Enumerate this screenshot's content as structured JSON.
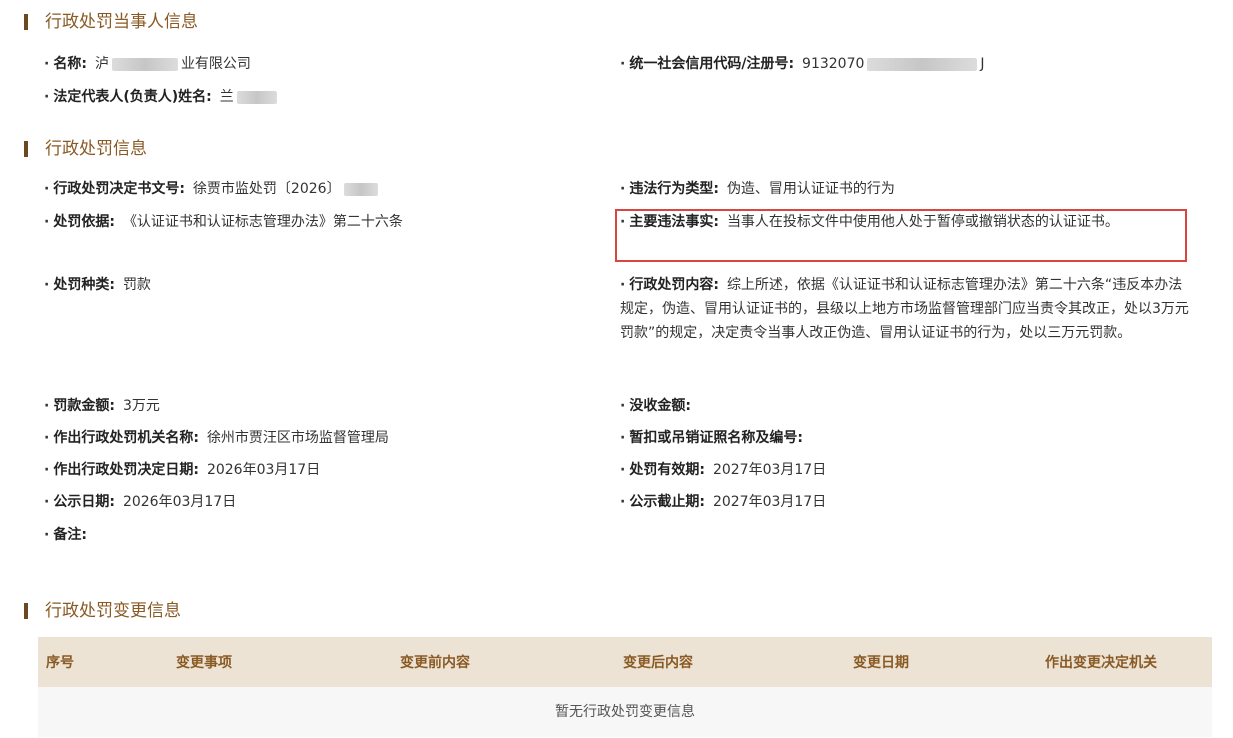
{
  "party": {
    "title": "行政处罚当事人信息",
    "name_label": "名称:",
    "name_prefix": "泸",
    "name_suffix": "业有限公司",
    "credit_label": "统一社会信用代码/注册号:",
    "credit_prefix": "9132070",
    "credit_suffix": "J",
    "rep_label": "法定代表人(负责人)姓名:",
    "rep_prefix": "兰"
  },
  "penalty": {
    "title": "行政处罚信息",
    "doc_no_label": "行政处罚决定书文号:",
    "doc_no_value": "徐贾市监处罚〔2026〕",
    "violation_type_label": "违法行为类型:",
    "violation_type_value": "伪造、冒用认证证书的行为",
    "basis_label": "处罚依据:",
    "basis_value": "《认证证书和认证标志管理办法》第二十六条",
    "facts_label": "主要违法事实:",
    "facts_value": "当事人在投标文件中使用他人处于暂停或撤销状态的认证证书。",
    "kind_label": "处罚种类:",
    "kind_value": "罚款",
    "content_label": "行政处罚内容:",
    "content_value": "综上所述，依据《认证证书和认证标志管理办法》第二十六条“违反本办法规定，伪造、冒用认证证书的，县级以上地方市场监督管理部门应当责令其改正，处以3万元罚款”的规定，决定责令当事人改正伪造、冒用认证证书的行为，处以三万元罚款。",
    "fine_label": "罚款金额:",
    "fine_value": "3万元",
    "confiscate_label": "没收金额:",
    "confiscate_value": "",
    "org_label": "作出行政处罚机关名称:",
    "org_value": "徐州市贾汪区市场监督管理局",
    "license_label": "暂扣或吊销证照名称及编号:",
    "license_value": "",
    "decision_date_label": "作出行政处罚决定日期:",
    "decision_date_value": "2026年03月17日",
    "validity_label": "处罚有效期:",
    "validity_value": "2027年03月17日",
    "publish_date_label": "公示日期:",
    "publish_date_value": "2026年03月17日",
    "publish_end_label": "公示截止期:",
    "publish_end_value": "2027年03月17日",
    "remark_label": "备注:",
    "remark_value": ""
  },
  "changes": {
    "title": "行政处罚变更信息",
    "columns": [
      "序号",
      "变更事项",
      "变更前内容",
      "变更后内容",
      "变更日期",
      "作出变更决定机关"
    ],
    "empty_text": "暂无行政处罚变更信息"
  },
  "colors": {
    "accent": "#8a5a24",
    "table_header_bg": "#ece3d5",
    "highlight_border": "#d9453f"
  }
}
